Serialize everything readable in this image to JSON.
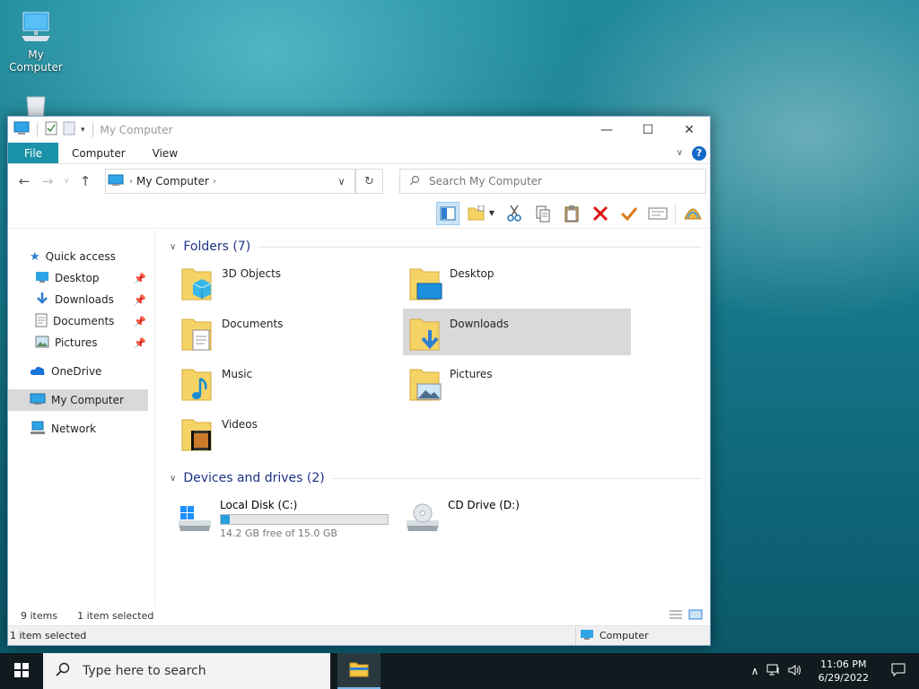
{
  "desktop": {
    "icons": [
      {
        "label": "My Computer"
      },
      {
        "label": ""
      }
    ]
  },
  "window": {
    "title": "My Computer",
    "controls": {
      "minimize": "—",
      "maximize": "☐",
      "close": "✕"
    },
    "tabs": {
      "file": "File",
      "computer": "Computer",
      "view": "View"
    },
    "help": "?",
    "address": {
      "crumb": "My Computer"
    },
    "search_placeholder": "Search My Computer",
    "nav": {
      "quick_access": "Quick access",
      "desktop": "Desktop",
      "downloads": "Downloads",
      "documents": "Documents",
      "pictures": "Pictures",
      "onedrive": "OneDrive",
      "my_computer": "My Computer",
      "network": "Network"
    },
    "folders_header": "Folders (7)",
    "folders": [
      {
        "name": "3D Objects"
      },
      {
        "name": "Desktop"
      },
      {
        "name": "Documents"
      },
      {
        "name": "Downloads"
      },
      {
        "name": "Music"
      },
      {
        "name": "Pictures"
      },
      {
        "name": "Videos"
      }
    ],
    "selected_folder": "Downloads",
    "drives_header": "Devices and drives (2)",
    "drives": [
      {
        "name": "Local Disk (C:)",
        "free_text": "14.2 GB free of 15.0 GB",
        "used_fraction": 0.053
      },
      {
        "name": "CD Drive (D:)"
      }
    ],
    "status": {
      "items": "9 items",
      "selected": "1 item selected"
    },
    "bottom": {
      "selected": "1 item selected",
      "zone": "Computer"
    }
  },
  "taskbar": {
    "search_placeholder": "Type here to search",
    "time": "11:06 PM",
    "date": "6/29/2022"
  },
  "colors": {
    "accent": "#1a93a8",
    "folder": "#f6d365",
    "selection": "#d9d9d9"
  }
}
